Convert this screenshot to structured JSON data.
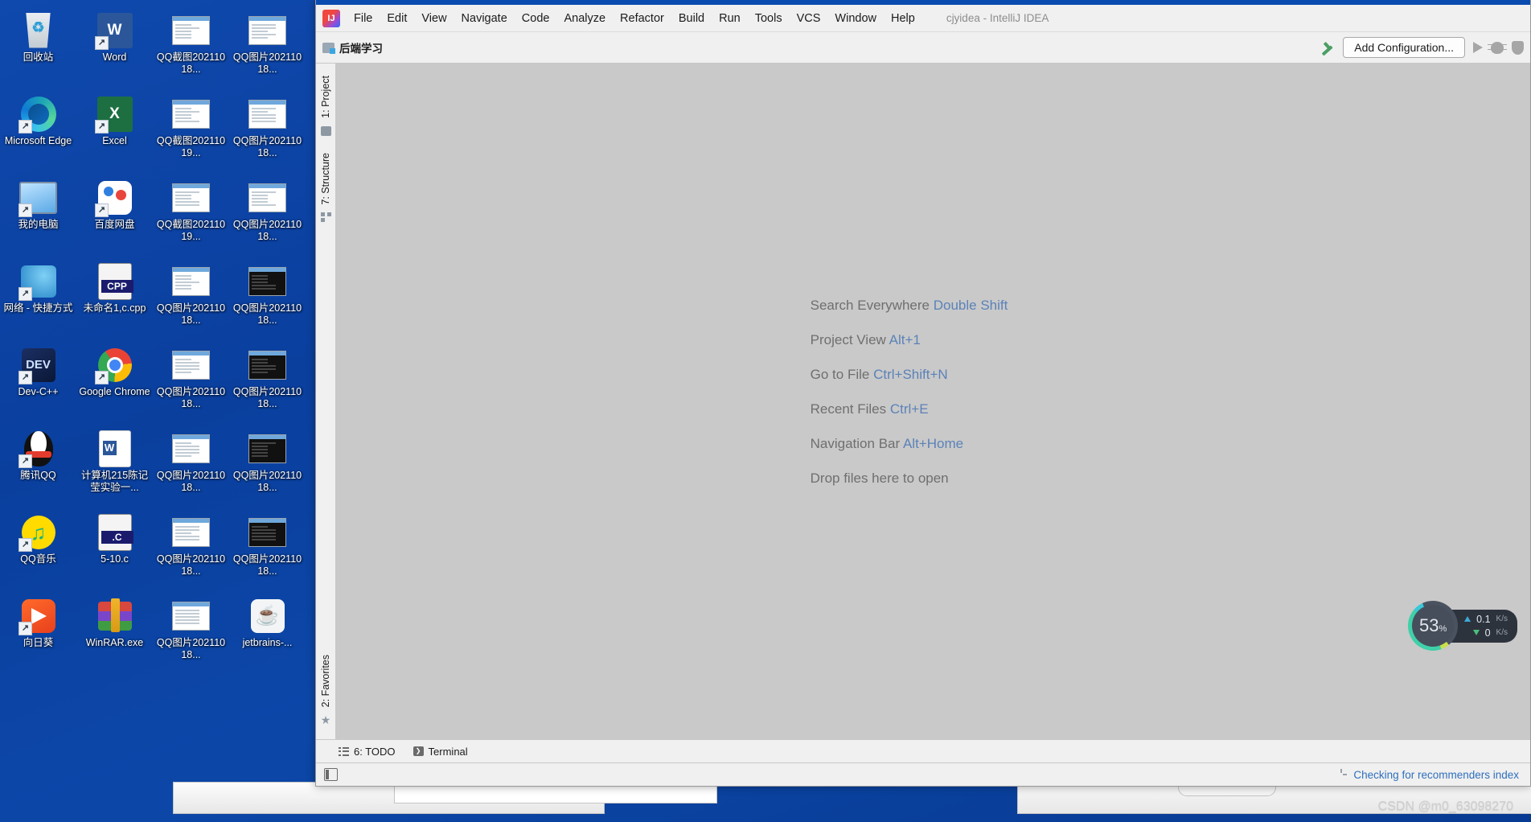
{
  "desktop": {
    "icons": [
      {
        "label": "回收站",
        "art": "art-recycle",
        "shortcut": false
      },
      {
        "label": "Word",
        "art": "art-word",
        "shortcut": true
      },
      {
        "label": "QQ截图20211018...",
        "art": "thumb-light",
        "shortcut": false
      },
      {
        "label": "QQ图片20211018...",
        "art": "thumb-light",
        "shortcut": false
      },
      {
        "label": "Microsoft Edge",
        "art": "art-edge",
        "shortcut": true
      },
      {
        "label": "Excel",
        "art": "art-excel",
        "shortcut": true
      },
      {
        "label": "QQ截图20211019...",
        "art": "thumb-light",
        "shortcut": false
      },
      {
        "label": "QQ图片20211018...",
        "art": "thumb-light",
        "shortcut": false
      },
      {
        "label": "我的电脑",
        "art": "art-pc",
        "shortcut": true
      },
      {
        "label": "百度网盘",
        "art": "art-baidu",
        "shortcut": true
      },
      {
        "label": "QQ截图20211019...",
        "art": "thumb-light",
        "shortcut": false
      },
      {
        "label": "QQ图片20211018...",
        "art": "thumb-light",
        "shortcut": false
      },
      {
        "label": "网络 - 快捷方式",
        "art": "art-net",
        "shortcut": true
      },
      {
        "label": "未命名1,c.cpp",
        "art": "art-cpp",
        "shortcut": false
      },
      {
        "label": "QQ图片20211018...",
        "art": "thumb-light",
        "shortcut": false
      },
      {
        "label": "QQ图片20211018...",
        "art": "thumb-dark",
        "shortcut": false
      },
      {
        "label": "Dev-C++",
        "art": "art-dev",
        "shortcut": true
      },
      {
        "label": "Google Chrome",
        "art": "art-chrome",
        "shortcut": true
      },
      {
        "label": "QQ图片20211018...",
        "art": "thumb-light",
        "shortcut": false
      },
      {
        "label": "QQ图片20211018...",
        "art": "thumb-dark",
        "shortcut": false
      },
      {
        "label": "腾讯QQ",
        "art": "art-qq",
        "shortcut": true
      },
      {
        "label": "计算机215陈记莹实验一...",
        "art": "art-doc",
        "shortcut": false
      },
      {
        "label": "QQ图片20211018...",
        "art": "thumb-light",
        "shortcut": false
      },
      {
        "label": "QQ图片20211018...",
        "art": "thumb-dark",
        "shortcut": false
      },
      {
        "label": "QQ音乐",
        "art": "art-qqmusic",
        "shortcut": true
      },
      {
        "label": "5-10.c",
        "art": "art-dotc",
        "shortcut": false
      },
      {
        "label": "QQ图片20211018...",
        "art": "thumb-light",
        "shortcut": false
      },
      {
        "label": "QQ图片20211018...",
        "art": "thumb-dark",
        "shortcut": false
      },
      {
        "label": "向日葵",
        "art": "art-sun",
        "shortcut": true
      },
      {
        "label": "WinRAR.exe",
        "art": "art-rar",
        "shortcut": false
      },
      {
        "label": "QQ图片20211018...",
        "art": "thumb-light",
        "shortcut": false
      },
      {
        "label": "jetbrains-...",
        "art": "art-java",
        "shortcut": false
      }
    ]
  },
  "ide": {
    "window_title": "cjyidea - IntelliJ IDEA",
    "logo_name": "intellij-idea-logo",
    "menus": [
      {
        "label": "File",
        "mnemonic": "F"
      },
      {
        "label": "Edit",
        "mnemonic": "E"
      },
      {
        "label": "View",
        "mnemonic": "V"
      },
      {
        "label": "Navigate",
        "mnemonic": "N"
      },
      {
        "label": "Code",
        "mnemonic": "C"
      },
      {
        "label": "Analyze",
        "mnemonic": "z"
      },
      {
        "label": "Refactor",
        "mnemonic": "R"
      },
      {
        "label": "Build",
        "mnemonic": "B"
      },
      {
        "label": "Run",
        "mnemonic": "u"
      },
      {
        "label": "Tools",
        "mnemonic": "T"
      },
      {
        "label": "VCS",
        "mnemonic": "S"
      },
      {
        "label": "Window",
        "mnemonic": "W"
      },
      {
        "label": "Help",
        "mnemonic": "H"
      }
    ],
    "toolbar": {
      "breadcrumb": "后端学习",
      "add_configuration_label": "Add Configuration...",
      "build_icon": "hammer-icon",
      "run_icon": "run-icon",
      "debug_icon": "debug-icon",
      "coverage_icon": "coverage-icon"
    },
    "tool_windows_left": [
      {
        "label": "1: Project",
        "mnemonic": "1",
        "icon": "project-folder-icon"
      },
      {
        "label": "7: Structure",
        "mnemonic": "7",
        "icon": "structure-icon"
      },
      {
        "label": "2: Favorites",
        "mnemonic": "2",
        "icon": "star-icon"
      }
    ],
    "editor_hints": [
      {
        "action": "Search Everywhere",
        "shortcut": "Double Shift"
      },
      {
        "action": "Project View",
        "shortcut": "Alt+1"
      },
      {
        "action": "Go to File",
        "shortcut": "Ctrl+Shift+N"
      },
      {
        "action": "Recent Files",
        "shortcut": "Ctrl+E"
      },
      {
        "action": "Navigation Bar",
        "shortcut": "Alt+Home"
      },
      {
        "action": "Drop files here to open",
        "shortcut": ""
      }
    ],
    "tool_window_buttons": [
      {
        "label": "6: TODO",
        "mnemonic": "6",
        "icon": "todo-icon"
      },
      {
        "label": "Terminal",
        "mnemonic": "",
        "icon": "terminal-icon"
      }
    ],
    "statusbar": {
      "layout_icon": "layout-toggle-icon",
      "progress_icon": "spinner-icon",
      "message": "Checking for recommenders index"
    }
  },
  "perf_widget": {
    "cpu_percent": "53",
    "percent_symbol": "%",
    "upload_value": "0.1",
    "upload_unit": "K/s",
    "download_value": "0",
    "download_unit": "K/s"
  },
  "watermark": "CSDN @m0_63098270",
  "colors": {
    "desktop_blue": "#0a3f9e",
    "ide_chrome": "#f0f0f0",
    "editor_bg": "#c9c9c9",
    "link_blue": "#5b82b8",
    "status_link": "#2f6fbd"
  }
}
